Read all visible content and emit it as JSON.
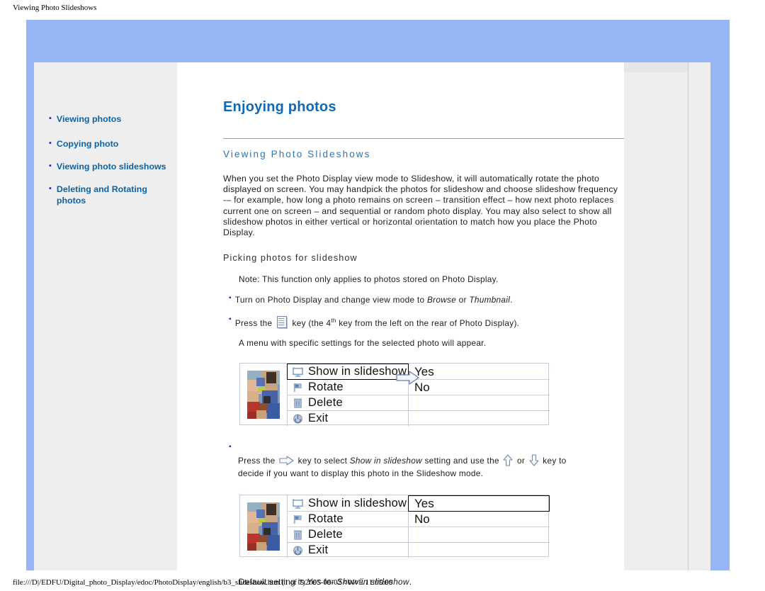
{
  "print": {
    "header": "Viewing Photo Slideshows",
    "footer": "file:///D|/EDFU/Digital_photo_Display/edoc/PhotoDisplay/english/b3_slideshow.htm (1 of 7)2005-08-02 ¤W¤È 11:05:00"
  },
  "sidebar": {
    "items": [
      {
        "label": "Viewing photos"
      },
      {
        "label": "Copying photo"
      },
      {
        "label": "Viewing photo slideshows"
      },
      {
        "label": "Deleting and Rotating photos"
      }
    ]
  },
  "main": {
    "page_title": "Enjoying photos",
    "section_title": "Viewing Photo Slideshows",
    "intro": "When you set the Photo Display view mode to Slideshow, it will automatically rotate the photo displayed on screen.  You may handpick the photos for slideshow and choose slideshow frequency -– for example, how long a photo remains on screen – transition effect – how next photo replaces current one on screen –  and sequential or random photo display.  You may also select to show all slideshow photos in either vertical or horizontal orientation to match how you place the Photo Display.",
    "sub_title": "Picking photos for slideshow",
    "note": "Note: This function only applies to photos stored on Photo Display.",
    "step1_a": "Turn on Photo Display and change view mode to ",
    "step1_em1": "Browse",
    "step1_b": " or ",
    "step1_em2": "Thumbnail",
    "step1_c": ".",
    "step2_a": "Press the ",
    "step2_b": " key (the 4",
    "step2_sup": "th",
    "step2_c": " key from the left on the rear of Photo Display).",
    "menu_appear": "A menu with specific settings for the selected photo will appear.",
    "step3_a": "Press the ",
    "step3_b": " key to select ",
    "step3_em1": "Show in slideshow",
    "step3_c": " setting and use the ",
    "step3_d": " or ",
    "step3_e": " key to",
    "step3_f": "decide if you want to display this photo in the Slideshow mode.",
    "default_a": "Default setting is ",
    "default_em1": "Yes",
    "default_b": " for ",
    "default_em2": "Show in slideshow",
    "default_c": "."
  },
  "menu_mock_1": {
    "rows": [
      {
        "icon": "monitor-icon",
        "label": "Show in slideshow",
        "value": "Yes"
      },
      {
        "icon": "flag-icon",
        "label": "Rotate",
        "value": "No"
      },
      {
        "icon": "trash-icon",
        "label": "Delete",
        "value": ""
      },
      {
        "icon": "power-icon",
        "label": "Exit",
        "value": ""
      }
    ],
    "highlighted": "label-row-0",
    "arrow": "right-arrow-icon"
  },
  "menu_mock_2": {
    "rows": [
      {
        "icon": "monitor-icon",
        "label": "Show in slideshow",
        "value": "Yes"
      },
      {
        "icon": "flag-icon",
        "label": "Rotate",
        "value": "No"
      },
      {
        "icon": "trash-icon",
        "label": "Delete",
        "value": ""
      },
      {
        "icon": "power-icon",
        "label": "Exit",
        "value": ""
      }
    ],
    "highlighted": "value-row-0"
  },
  "colors": {
    "band_blue": "#97b6f5",
    "panel_gray": "#eeeeee",
    "title_blue": "#1268b3",
    "section_blue": "#2b74bb",
    "link_blue": "#0d63a5",
    "bullet_blue": "#2b2bc8",
    "menu_icon_blue": "#7f9ec9"
  }
}
